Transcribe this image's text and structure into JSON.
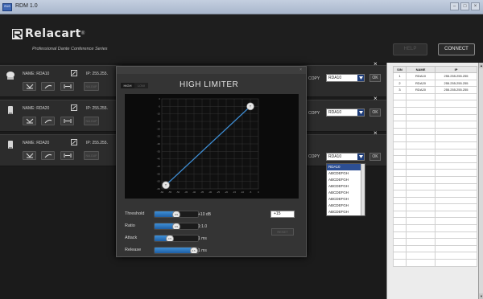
{
  "window": {
    "app_icon_text": "R10",
    "title": "RDM 1.0",
    "controls": [
      "–",
      "□",
      "×"
    ]
  },
  "header": {
    "logo_text": "Relacart",
    "logo_mark": "®",
    "tagline": "Professional Dante Conference Series",
    "help_label": "HELP",
    "connect_label": "CONNECT"
  },
  "devices": [
    {
      "name": "NAME: RDA10",
      "ip": "IP: 255.255.",
      "copy_label": "COPY",
      "copy_value": "RDA10",
      "ok_label": "OK",
      "close": "×",
      "btn4": "N/A DUP"
    },
    {
      "name": "NAME: RDA20",
      "ip": "IP: 255.255.",
      "copy_label": "COPY",
      "copy_value": "RDA10",
      "ok_label": "OK",
      "close": "×",
      "btn4": "N/A DUP"
    },
    {
      "name": "NAME: RDA20",
      "ip": "IP: 255.255.",
      "copy_label": "COPY",
      "copy_value": "RDA10",
      "ok_label": "OK",
      "close": "×",
      "btn4": "N/A DUP"
    }
  ],
  "dropdown": {
    "options": [
      "RDA10",
      "ABCDEFGH",
      "ABCDEFGH",
      "ABCDEFGH",
      "ABCDEFGH",
      "ABCDEFGH",
      "ABCDEFGH",
      "ABCDEFGH"
    ],
    "selected_index": 0
  },
  "dialog": {
    "close": "×",
    "title": "HIGH LIMITER",
    "tabs": [
      "HIGH",
      "LOW"
    ],
    "active_tab": 0,
    "graph": {
      "x_ticks": [
        "-60",
        "-55",
        "-50",
        "-45",
        "-40",
        "-35",
        "-30",
        "-25",
        "-20",
        "-15",
        "-10",
        "-5",
        "0"
      ],
      "y_ticks": [
        "0",
        "-5",
        "-10",
        "-15",
        "-20",
        "-25",
        "-30",
        "-35",
        "-40",
        "-45",
        "-50",
        "-55",
        "-60"
      ],
      "point_label": "T",
      "line_color": "#3f8fd6"
    },
    "params": [
      {
        "label": "Threshold",
        "value": "+10 dB",
        "fill": 0.5,
        "knob": "0.5"
      },
      {
        "label": "Ratio",
        "value": "1:1.0",
        "fill": 0.5,
        "knob": "0.5"
      },
      {
        "label": "Attack",
        "value": "1 ms",
        "fill": 0.35,
        "knob": "0.5"
      },
      {
        "label": "Release",
        "value": "1 ms",
        "fill": 0.9,
        "knob": "0.5"
      }
    ],
    "threshold_input": "+15",
    "reset_label": "RESET"
  },
  "table": {
    "headers": [
      "S/N",
      "NAME",
      "IP"
    ],
    "rows": [
      [
        "1",
        "RDA10",
        "255.255.255.255"
      ],
      [
        "2",
        "RDA20",
        "255.255.255.255"
      ],
      [
        "3",
        "RDA20",
        "255.255.255.255"
      ]
    ],
    "empty_rows": 25
  }
}
